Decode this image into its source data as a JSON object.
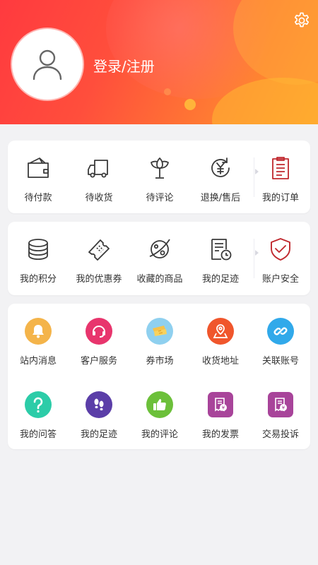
{
  "header": {
    "login_label": "登录/注册",
    "settings_icon": "gear-icon",
    "avatar_icon": "user-icon"
  },
  "orders": [
    {
      "label": "待付款",
      "icon": "wallet-icon"
    },
    {
      "label": "待收货",
      "icon": "truck-icon"
    },
    {
      "label": "待评论",
      "icon": "tulip-icon"
    },
    {
      "label": "退换/售后",
      "icon": "yen-refresh-icon"
    },
    {
      "label": "我的订单",
      "icon": "order-list-icon"
    }
  ],
  "assets": [
    {
      "label": "我的积分",
      "icon": "coin-stack-icon"
    },
    {
      "label": "我的优惠券",
      "icon": "ticket-icon"
    },
    {
      "label": "收藏的商品",
      "icon": "planet-icon"
    },
    {
      "label": "我的足迹",
      "icon": "history-doc-icon"
    },
    {
      "label": "账户安全",
      "icon": "shield-check-icon"
    }
  ],
  "services": [
    {
      "label": "站内消息",
      "icon": "bell-icon",
      "color": "#f4b44a"
    },
    {
      "label": "客户服务",
      "icon": "headset-icon",
      "color": "#e8356d"
    },
    {
      "label": "券市场",
      "icon": "coupon-icon",
      "color": "#8fd0ef"
    },
    {
      "label": "收货地址",
      "icon": "map-pin-icon",
      "color": "#f0562c"
    },
    {
      "label": "关联账号",
      "icon": "link-icon",
      "color": "#31a9ea"
    },
    {
      "label": "我的问答",
      "icon": "question-icon",
      "color": "#2ccca8"
    },
    {
      "label": "我的足迹",
      "icon": "footprints-icon",
      "color": "#5b3ea8"
    },
    {
      "label": "我的评论",
      "icon": "thumbs-up-icon",
      "color": "#6cc03a"
    },
    {
      "label": "我的发票",
      "icon": "invoice-icon",
      "color": "#a8449a"
    },
    {
      "label": "交易投诉",
      "icon": "complaint-icon",
      "color": "#a8449a"
    }
  ]
}
